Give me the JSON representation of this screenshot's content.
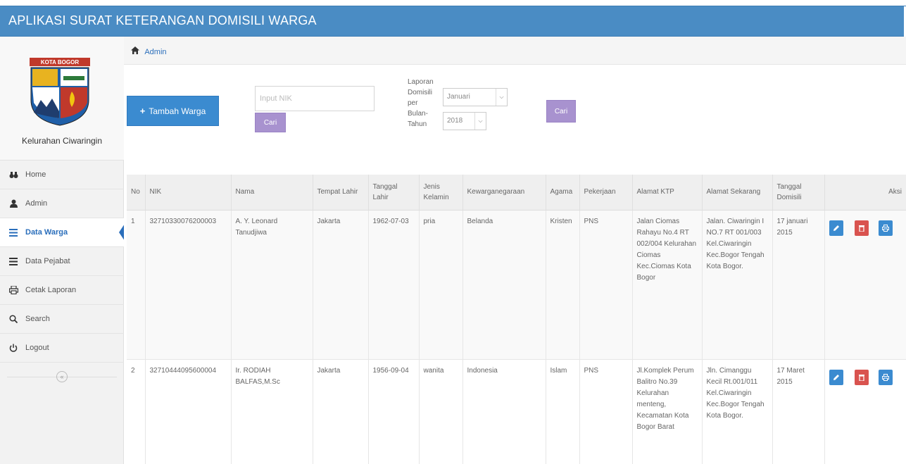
{
  "app": {
    "title": "APLIKASI SURAT KETERANGAN DOMISILI WARGA"
  },
  "brand": {
    "logo_text": "KOTA BOGOR",
    "name": "Kelurahan Ciwaringin"
  },
  "nav": {
    "items": [
      {
        "label": "Home",
        "icon": "binoculars-icon"
      },
      {
        "label": "Admin",
        "icon": "user-icon"
      },
      {
        "label": "Data Warga",
        "icon": "list-icon",
        "active": true
      },
      {
        "label": "Data Pejabat",
        "icon": "list-icon"
      },
      {
        "label": "Cetak Laporan",
        "icon": "print-icon"
      },
      {
        "label": "Search",
        "icon": "search-icon"
      },
      {
        "label": "Logout",
        "icon": "power-icon"
      }
    ],
    "collapse_glyph": "«"
  },
  "breadcrumb": {
    "label": "Admin"
  },
  "toolbar": {
    "add_label": "Tambah Warga",
    "nik_placeholder": "Input NIK",
    "cari_label": "Cari",
    "laporan_label_lines": [
      "Laporan",
      "Domisili",
      "per",
      "Bulan-",
      "Tahun"
    ],
    "bulan_selected": "Januari",
    "tahun_selected": "2018",
    "cari2_label": "Cari"
  },
  "table": {
    "headers": [
      "No",
      "NIK",
      "Nama",
      "Tempat Lahir",
      "Tanggal Lahir",
      "Jenis Kelamin",
      "Kewarganegaraan",
      "Agama",
      "Pekerjaan",
      "Alamat KTP",
      "Alamat Sekarang",
      "Tanggal Domisili",
      "Aksi"
    ],
    "rows": [
      {
        "no": "1",
        "nik": "32710330076200003",
        "nama": "A. Y. Leonard Tanudjiwa",
        "tempat_lahir": "Jakarta",
        "tanggal_lahir": "1962-07-03",
        "jenis_kelamin": "pria",
        "kewarganegaraan": "Belanda",
        "agama": "Kristen",
        "pekerjaan": "PNS",
        "alamat_ktp": "Jalan Ciomas Rahayu No.4 RT 002/004 Kelurahan Ciomas Kec.Ciomas Kota Bogor",
        "alamat_sekarang": "Jalan. Ciwaringin I NO.7 RT 001/003 Kel.Ciwaringin Kec.Bogor Tengah Kota Bogor.",
        "tanggal_domisili": "17 januari 2015"
      },
      {
        "no": "2",
        "nik": "32710444095600004",
        "nama": "Ir. RODIAH BALFAS,M.Sc",
        "tempat_lahir": "Jakarta",
        "tanggal_lahir": "1956-09-04",
        "jenis_kelamin": "wanita",
        "kewarganegaraan": "Indonesia",
        "agama": "Islam",
        "pekerjaan": "PNS",
        "alamat_ktp": "Jl.Komplek Perum Balitro No.39 Kelurahan menteng, Kecamatan Kota Bogor Barat",
        "alamat_sekarang": "Jln. Cimanggu Kecil Rt.001/011 Kel.Ciwaringin Kec.Bogor Tengah Kota Bogor.",
        "tanggal_domisili": "17 Maret 2015"
      }
    ]
  },
  "colors": {
    "topbar": "#4a8cc4",
    "primary": "#3b8bd0",
    "danger": "#d9534f",
    "purple": "#a892cf"
  }
}
